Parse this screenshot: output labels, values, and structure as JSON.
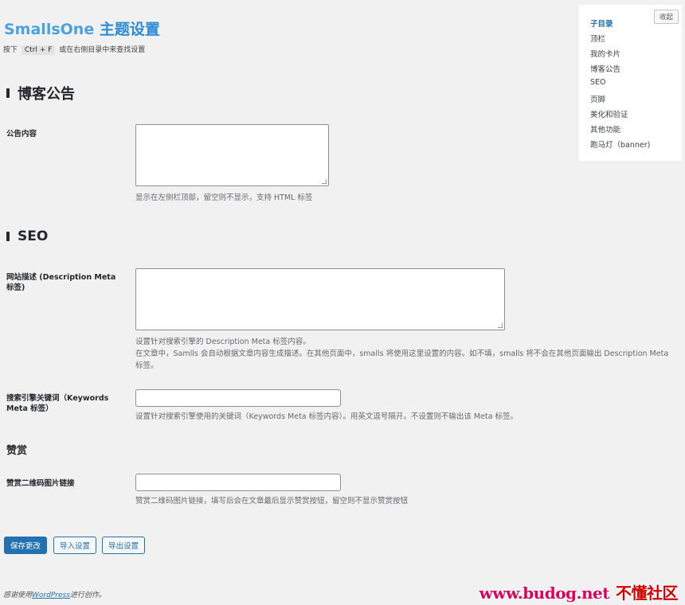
{
  "header": {
    "title_brand": "SmallsOne",
    "title_rest": " 主题设置",
    "hint_prefix": "按下",
    "hint_key": "Ctrl + F",
    "hint_suffix": "或在右侧目录中来查找设置"
  },
  "sections": {
    "announcement": {
      "title": "博客公告",
      "field_label": "公告内容",
      "field_value": "",
      "description": "显示在左侧栏顶部，留空则不显示，支持 HTML 标签"
    },
    "seo": {
      "title": "SEO",
      "description_label": "网站描述 (Description Meta 标签)",
      "description_value": "",
      "description_help_1": "设置针对搜索引擎的 Description Meta 标签内容。",
      "description_help_2": "在文章中，Samlls 会自动根据文章内容生成描述。在其他页面中，smalls 将使用这里设置的内容。如不填，smalls 将不会在其他页面输出 Description Meta 标签。",
      "keywords_label": "搜索引擎关键词（Keywords Meta 标签）",
      "keywords_value": "",
      "keywords_help": "设置针对搜索引擎使用的关键词（Keywords Meta 标签内容）。用英文逗号隔开。不设置则不输出该 Meta 标签。"
    },
    "donate": {
      "title": "赞赏",
      "qr_label": "赞赏二维码图片链接",
      "qr_value": "",
      "qr_help": "赞赏二维码图片链接，填写后会在文章最后显示赞赏按钮，留空则不显示赞赏按钮"
    }
  },
  "actions": {
    "save": "保存更改",
    "import": "导入设置",
    "export": "导出设置"
  },
  "toc": {
    "collapse": "收起",
    "items": [
      "子目录",
      "顶栏",
      "我的卡片",
      "博客公告",
      "SEO",
      "页脚",
      "美化和验证",
      "其他功能",
      "跑马灯（banner)"
    ]
  },
  "footer": {
    "prefix": "感谢使用",
    "link": "WordPress",
    "suffix": "进行创作。"
  },
  "watermark": {
    "site": "www.budog.net",
    "name": "不懂社区"
  },
  "colors": {
    "primary": "#2271b1",
    "title": "#2e8bd6",
    "background": "#f1f1f1"
  }
}
